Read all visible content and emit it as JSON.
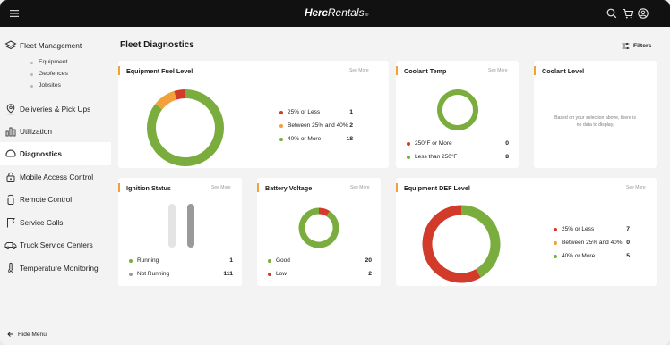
{
  "app": {
    "brand_bold": "Herc",
    "brand_regular": "Rentals",
    "brand_mark": "®"
  },
  "sidebar": {
    "items": [
      {
        "label": "Fleet Management",
        "icon": "layers-icon"
      },
      {
        "label": "Deliveries & Pick Ups",
        "icon": "location-pin-icon"
      },
      {
        "label": "Utilization",
        "icon": "bar-chart-icon"
      },
      {
        "label": "Diagnostics",
        "icon": "gauge-icon",
        "active": true
      },
      {
        "label": "Mobile Access Control",
        "icon": "lock-icon"
      },
      {
        "label": "Remote Control",
        "icon": "remote-icon"
      },
      {
        "label": "Service Calls",
        "icon": "flag-icon"
      },
      {
        "label": "Truck Service Centers",
        "icon": "truck-icon"
      },
      {
        "label": "Temperature Monitoring",
        "icon": "thermometer-icon"
      }
    ],
    "sub_items": [
      "Equipment",
      "Geofences",
      "Jobsites"
    ],
    "hide_menu": "Hide Menu"
  },
  "main": {
    "title": "Fleet Diagnostics",
    "filters_label": "Filters"
  },
  "colors": {
    "green": "#7aad3d",
    "orange": "#f2a13a",
    "red": "#d23a2a",
    "gray": "#9a9a9a",
    "accent": "#f2a13a"
  },
  "cards": {
    "fuel": {
      "title": "Equipment Fuel Level",
      "see_more": "See More",
      "legend": [
        {
          "label": "25% or Less",
          "value": "1",
          "color": "red"
        },
        {
          "label": "Between 25% and 40%",
          "value": "2",
          "color": "orange"
        },
        {
          "label": "40% or More",
          "value": "18",
          "color": "green"
        }
      ]
    },
    "coolant_temp": {
      "title": "Coolant Temp",
      "see_more": "See More",
      "legend": [
        {
          "label": "250°F or More",
          "value": "0",
          "color": "red"
        },
        {
          "label": "Less than 250°F",
          "value": "8",
          "color": "green"
        }
      ]
    },
    "coolant_level": {
      "title": "Coolant Level",
      "empty_line1": "Based on your selection above, there is",
      "empty_line2": "no data to display."
    },
    "ignition": {
      "title": "Ignition Status",
      "see_more": "See More",
      "legend": [
        {
          "label": "Running",
          "value": "1",
          "color": "green"
        },
        {
          "label": "Not Running",
          "value": "111",
          "color": "gray"
        }
      ]
    },
    "battery": {
      "title": "Battery Voltage",
      "see_more": "See More",
      "legend": [
        {
          "label": "Good",
          "value": "20",
          "color": "green"
        },
        {
          "label": "Low",
          "value": "2",
          "color": "red"
        }
      ]
    },
    "def": {
      "title": "Equipment DEF Level",
      "see_more": "See More",
      "legend": [
        {
          "label": "25% or Less",
          "value": "7",
          "color": "red"
        },
        {
          "label": "Between 25% and 40%",
          "value": "0",
          "color": "orange"
        },
        {
          "label": "40% or More",
          "value": "5",
          "color": "green"
        }
      ]
    }
  }
}
